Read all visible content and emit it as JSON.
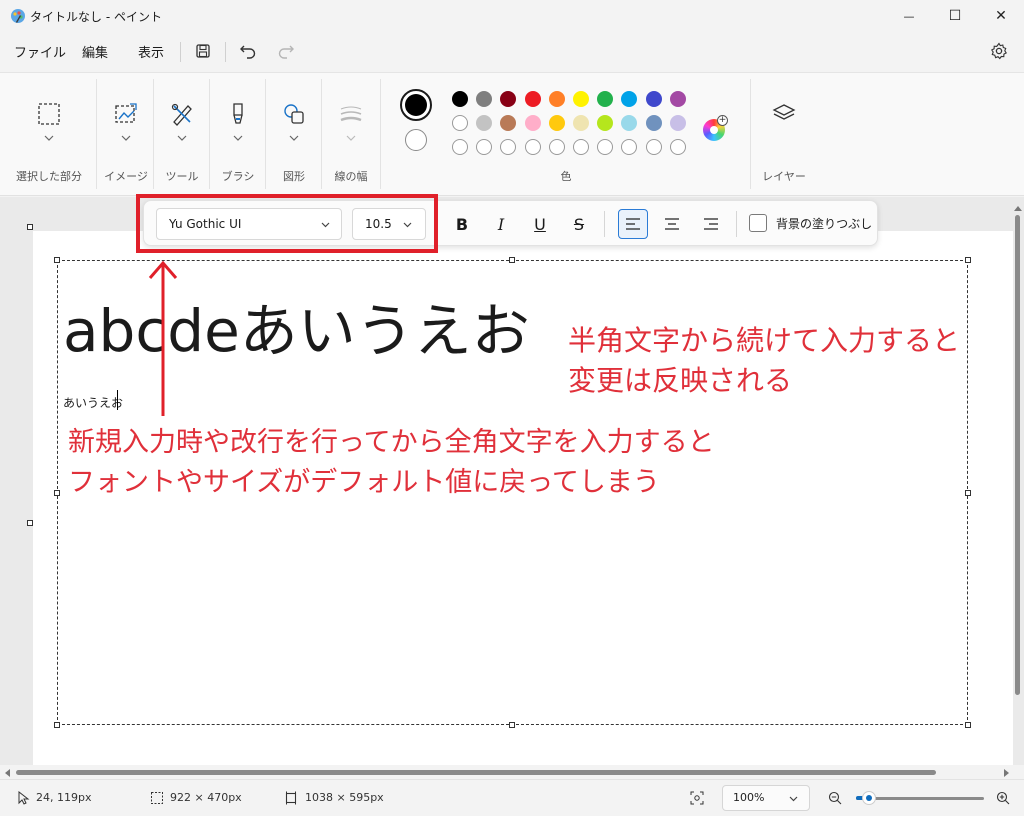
{
  "window": {
    "title": "タイトルなし - ペイント",
    "minimize_glyph": "—",
    "maximize_glyph": "☐",
    "close_glyph": "✕"
  },
  "menu": {
    "file": "ファイル",
    "edit": "編集",
    "view": "表示"
  },
  "ribbon": {
    "groups": [
      {
        "label": "選択した部分",
        "icon": "selection-icon"
      },
      {
        "label": "イメージ",
        "icon": "image-icon"
      },
      {
        "label": "ツール",
        "icon": "tools-icon"
      },
      {
        "label": "ブラシ",
        "icon": "brush-icon"
      },
      {
        "label": "図形",
        "icon": "shapes-icon"
      },
      {
        "label": "線の幅",
        "icon": "line-width-icon"
      }
    ],
    "colors_label": "色",
    "layers_label": "レイヤー",
    "primary_color": "#000000",
    "secondary_color": "#ffffff",
    "palette_row1": [
      "#000000",
      "#7f7f7f",
      "#880015",
      "#ed1c24",
      "#ff7f27",
      "#fff200",
      "#22b14c",
      "#00a2e8",
      "#3f48cc",
      "#a349a4"
    ],
    "palette_row2": [
      "#ffffff",
      "#c3c3c3",
      "#b97a57",
      "#ffaec9",
      "#ffc90e",
      "#efe4b0",
      "#b5e61d",
      "#99d9ea",
      "#7092be",
      "#c8bfe7"
    ]
  },
  "text_toolbar": {
    "font": "Yu Gothic UI",
    "size": "10.5",
    "bold": "B",
    "italic": "I",
    "underline": "U",
    "strike": "S",
    "fill_background_label": "背景の塗りつぶし"
  },
  "canvas": {
    "big_text": "abcdeあいうえお",
    "small_text": "あいうえお"
  },
  "annotations": {
    "right_line1": "半角文字から続けて入力すると",
    "right_line2": "変更は反映される",
    "bottom_line1": "新規入力時や改行を行ってから全角文字を入力すると",
    "bottom_line2": "フォントやサイズがデフォルト値に戻ってしまう",
    "color": "#e0303a"
  },
  "status": {
    "cursor_pos": "24, 119px",
    "selection_size": "922 × 470px",
    "canvas_size": "1038 × 595px",
    "zoom": "100%",
    "zoom_fraction": 0.1
  }
}
